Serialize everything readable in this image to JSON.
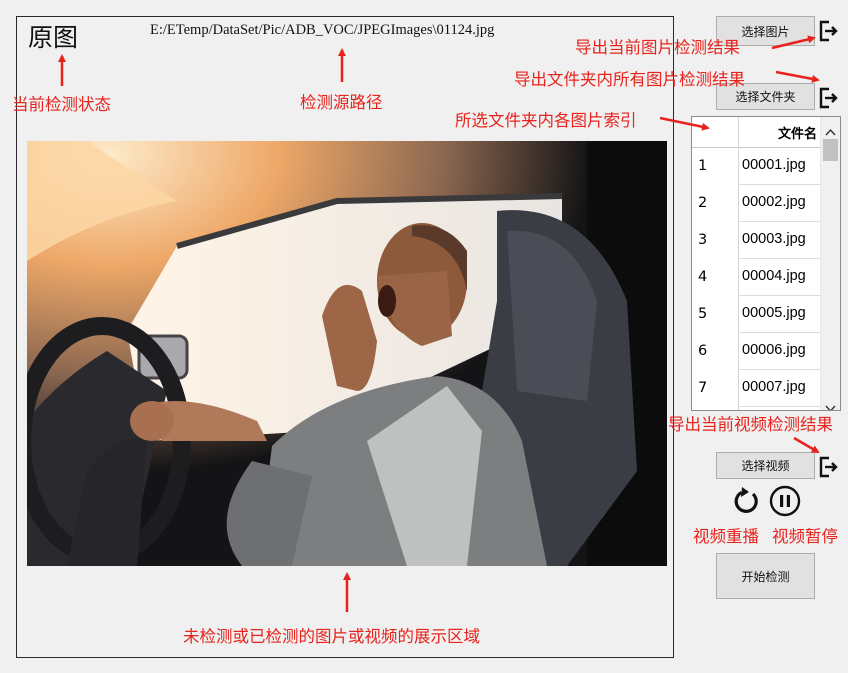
{
  "header": {
    "status": "原图",
    "source_path": "E:/ETemp/DataSet/Pic/ADB_VOC/JPEGImages\\01124.jpg"
  },
  "buttons": {
    "select_image": "选择图片",
    "select_folder": "选择文件夹",
    "select_video": "选择视频",
    "start_detect": "开始检测"
  },
  "file_table": {
    "header_name": "文件名",
    "rows": [
      {
        "index": "1",
        "name": "00001.jpg"
      },
      {
        "index": "2",
        "name": "00002.jpg"
      },
      {
        "index": "3",
        "name": "00003.jpg"
      },
      {
        "index": "4",
        "name": "00004.jpg"
      },
      {
        "index": "5",
        "name": "00005.jpg"
      },
      {
        "index": "6",
        "name": "00006.jpg"
      },
      {
        "index": "7",
        "name": "00007.jpg"
      }
    ]
  },
  "icons": {
    "export": "export-icon",
    "replay": "replay-icon",
    "pause": "pause-icon",
    "scroll_up": "chevron-up-icon",
    "scroll_down": "chevron-down-icon"
  },
  "annotations": {
    "export_image": "导出当前图片检测结果",
    "export_folder": "导出文件夹内所有图片检测结果",
    "folder_index": "所选文件夹内各图片索引",
    "status": "当前检测状态",
    "source": "检测源路径",
    "export_video": "导出当前视频检测结果",
    "replay": "视频重播",
    "pause": "视频暂停",
    "display_area": "未检测或已检测的图片或视频的展示区域"
  },
  "colors": {
    "annotation": "#e8231d",
    "background": "#f0f0f0",
    "button_face": "#e1e1e1"
  }
}
